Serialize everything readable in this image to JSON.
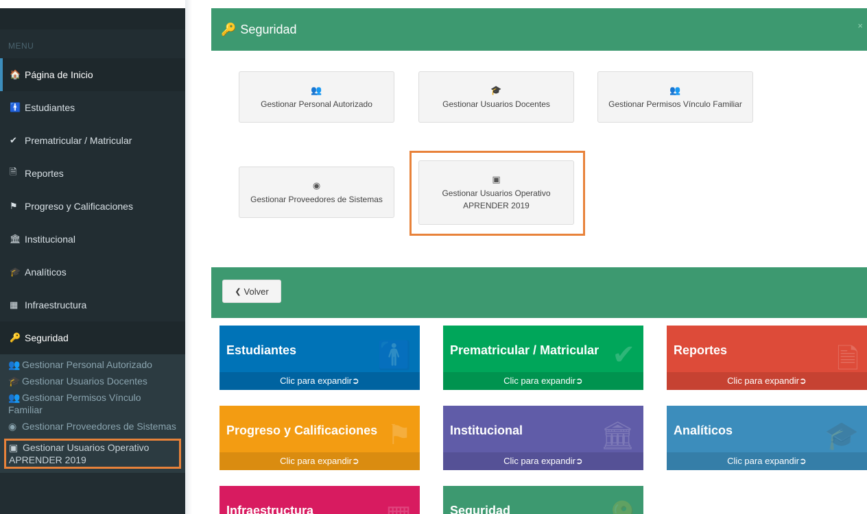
{
  "sidebar": {
    "menu_label": "MENU",
    "items": [
      {
        "label": "Página de Inicio",
        "icon": "home-icon",
        "glyph": "🏠"
      },
      {
        "label": "Estudiantes",
        "icon": "student-icon",
        "glyph": "🚹"
      },
      {
        "label": "Prematricular / Matricular",
        "icon": "check-icon",
        "glyph": "✔"
      },
      {
        "label": "Reportes",
        "icon": "file-icon",
        "glyph": "🗎"
      },
      {
        "label": "Progreso y Calificaciones",
        "icon": "flag-icon",
        "glyph": "⚑"
      },
      {
        "label": "Institucional",
        "icon": "institution-icon",
        "glyph": "🏛"
      },
      {
        "label": "Analíticos",
        "icon": "graduation-cap-icon",
        "glyph": "🎓"
      },
      {
        "label": "Infraestructura",
        "icon": "building-icon",
        "glyph": "▦"
      },
      {
        "label": "Seguridad",
        "icon": "key-icon",
        "glyph": "🔑"
      }
    ],
    "submenu": [
      {
        "label": "Gestionar Personal Autorizado",
        "icon": "users-icon",
        "glyph": "👥"
      },
      {
        "label": "Gestionar Usuarios Docentes",
        "icon": "graduation-cap-icon",
        "glyph": "🎓"
      },
      {
        "label": "Gestionar Permisos Vínculo Familiar",
        "icon": "users-icon",
        "glyph": "👥"
      },
      {
        "label": "Gestionar Proveedores de Sistemas",
        "icon": "user-circle-icon",
        "glyph": "◉"
      },
      {
        "label": "Gestionar Usuarios Operativo APRENDER 2019",
        "icon": "id-card-icon",
        "glyph": "▣"
      }
    ]
  },
  "panel": {
    "title": "Seguridad",
    "title_glyph": "🔑",
    "close_glyph": "×",
    "buttons": [
      {
        "label": "Gestionar Personal Autorizado",
        "glyph": "👥"
      },
      {
        "label": "Gestionar Usuarios Docentes",
        "glyph": "🎓"
      },
      {
        "label": "Gestionar Permisos Vínculo Familiar",
        "glyph": "👥"
      },
      {
        "label": "Gestionar Proveedores de Sistemas",
        "glyph": "◉"
      },
      {
        "label": "Gestionar Usuarios Operativo APRENDER 2019",
        "glyph": "▣"
      }
    ]
  },
  "volver": {
    "label": "Volver",
    "glyph": "❮"
  },
  "tiles": [
    {
      "name": "Estudiantes",
      "footer": "Clic para expandir➲",
      "glyph": "🚹",
      "color": "#0073b7",
      "footer_color": "#0063a0"
    },
    {
      "name": "Prematricular / Matricular",
      "footer": "Clic para expandir➲",
      "glyph": "✔",
      "color": "#00a65a",
      "footer_color": "#00934f"
    },
    {
      "name": "Reportes",
      "footer": "Clic para expandir➲",
      "glyph": "🗎",
      "color": "#dd4b39",
      "footer_color": "#c64232"
    },
    {
      "name": "Progreso y Calificaciones",
      "footer": "Clic para expandir➲",
      "glyph": "⚑",
      "color": "#f39c12",
      "footer_color": "#da8c10"
    },
    {
      "name": "Institucional",
      "footer": "Clic para expandir➲",
      "glyph": "🏛",
      "color": "#605ca8",
      "footer_color": "#555196"
    },
    {
      "name": "Analíticos",
      "footer": "Clic para expandir➲",
      "glyph": "🎓",
      "color": "#3c8dbc",
      "footer_color": "#357ea8"
    },
    {
      "name": "Infraestructura",
      "footer": "",
      "glyph": "▦",
      "color": "#d81b60",
      "footer_color": "#c01856"
    },
    {
      "name": "Seguridad",
      "footer": "",
      "glyph": "🔑",
      "color": "#3d9970",
      "footer_color": "#368863"
    }
  ]
}
